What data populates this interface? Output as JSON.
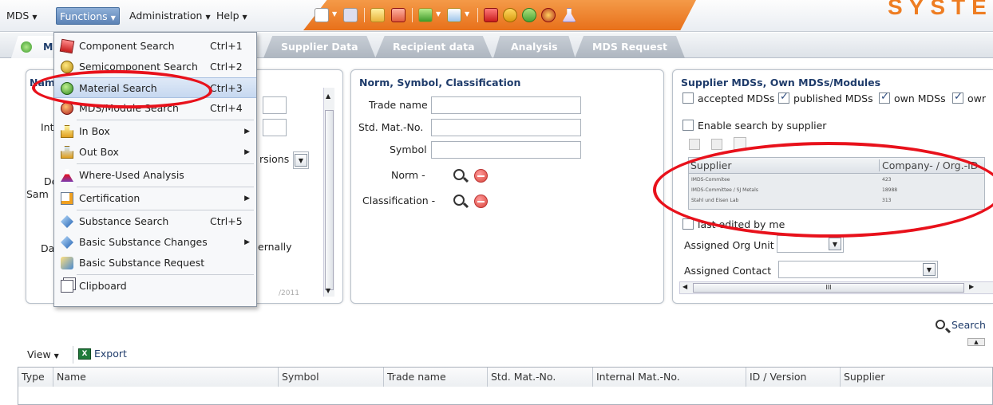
{
  "menubar": {
    "menus": [
      "MDS",
      "Functions",
      "Administration",
      "Help"
    ],
    "brand": "SYSTE"
  },
  "tabs": [
    "M",
    "Supplier Data",
    "Recipient data",
    "Analysis",
    "MDS Request"
  ],
  "left_panel": {
    "title_frag": "Nam",
    "int_frag": "Int",
    "de_frag": "De",
    "sam_frag": "Sam",
    "dat_frag": "Dat",
    "versions_frag": "rsions",
    "ernally_frag": "ernally",
    "date_frag": "/2011"
  },
  "norm_panel": {
    "title": "Norm, Symbol, Classification",
    "trade_name": "Trade name",
    "std_mat_no": "Std. Mat.-No.",
    "symbol": "Symbol",
    "norm": "Norm  -",
    "classification": "Classification  -"
  },
  "supplier_panel": {
    "title": "Supplier MDSs, Own MDSs/Modules",
    "accepted": "accepted MDSs",
    "published": "published MDSs",
    "own": "own MDSs",
    "owr": "owr",
    "enable": "Enable search by supplier",
    "grid_cols": [
      "Supplier",
      "Company- / Org.-ID"
    ],
    "grid_rows": [
      {
        "name": "IMDS-Commitee",
        "id": "423"
      },
      {
        "name": "IMDS-Committee / SJ Metals",
        "id": "18988"
      },
      {
        "name": "Stahl und Eisen Lab",
        "id": "313"
      }
    ],
    "last_edited": "last edited by me",
    "org_unit": "Assigned Org Unit",
    "contact": "Assigned Contact",
    "scroll_mark": "III"
  },
  "dropdown": {
    "items": [
      {
        "label": "Component Search",
        "shortcut": "Ctrl+1"
      },
      {
        "label": "Semicomponent Search",
        "shortcut": "Ctrl+2"
      },
      {
        "label": "Material Search",
        "shortcut": "Ctrl+3"
      },
      {
        "label": "MDS/Module Search",
        "shortcut": "Ctrl+4"
      },
      {
        "label": "In Box",
        "shortcut": ""
      },
      {
        "label": "Out Box",
        "shortcut": ""
      },
      {
        "label": "Where-Used Analysis",
        "shortcut": ""
      },
      {
        "label": "Certification",
        "shortcut": ""
      },
      {
        "label": "Substance Search",
        "shortcut": "Ctrl+5"
      },
      {
        "label": "Basic Substance Changes",
        "shortcut": ""
      },
      {
        "label": "Basic Substance Request",
        "shortcut": ""
      },
      {
        "label": "Clipboard",
        "shortcut": ""
      }
    ]
  },
  "search_label": "Search",
  "view_label": "View",
  "export_label": "Export",
  "columns": [
    "Type",
    "Name",
    "Symbol",
    "Trade name",
    "Std. Mat.-No.",
    "Internal Mat.-No.",
    "ID / Version",
    "Supplier"
  ],
  "colors": {
    "accent": "#ee7d22",
    "highlight": "#e8111b",
    "title": "#1f3c6b"
  }
}
